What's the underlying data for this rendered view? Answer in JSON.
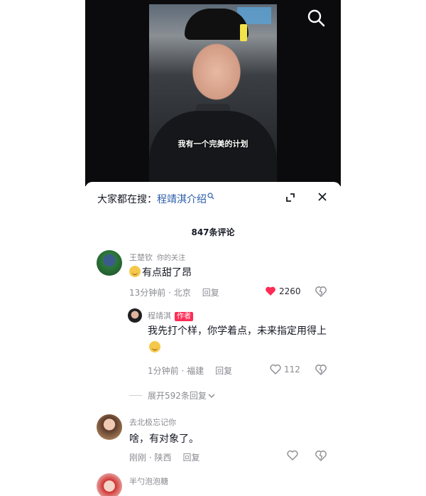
{
  "video": {
    "subtitle": "我有一个完美的计划"
  },
  "hot_search": {
    "prefix": "大家都在搜：",
    "keyword": "程靖淇介绍"
  },
  "comments_count": "847条评论",
  "comments": [
    {
      "username": "王楚钦",
      "badge": "你的关注",
      "text": "有点甜了昂",
      "time_location": "13分钟前 · 北京",
      "reply_label": "回复",
      "likes": "2260",
      "liked": true
    },
    {
      "username": "程靖淇",
      "author_badge": "作者",
      "text": "我先打个样，你学着点，未来指定用得上",
      "time_location": "1分钟前 · 福建",
      "reply_label": "回复",
      "likes": "112",
      "liked": false
    },
    {
      "expand_label": "展开592条回复"
    },
    {
      "username": "去北极忘记你",
      "text": "啥，有对象了。",
      "time_location": "刚刚 · 陕西",
      "reply_label": "回复",
      "liked": false
    },
    {
      "username": "半勺泡泡糖"
    }
  ],
  "colors": {
    "accent_red": "#fe2c55",
    "keyword_blue": "#2a5caa",
    "like_red": "#fe2c55"
  }
}
